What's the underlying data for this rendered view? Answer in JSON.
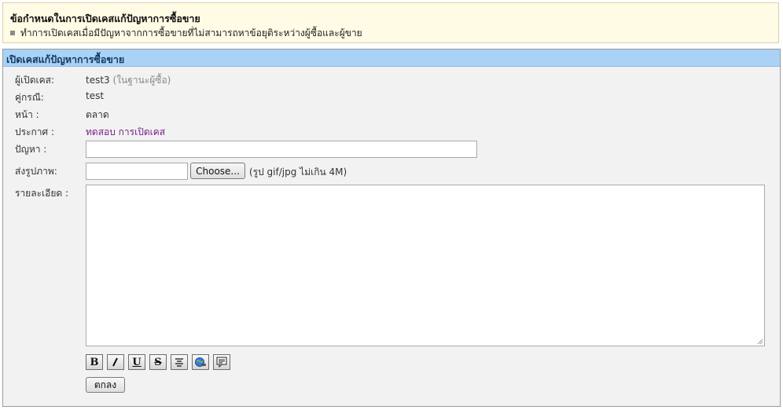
{
  "notice": {
    "title": "ข้อกำหนดในการเปิดเคสแก้ปัญหาการซื้อขาย",
    "items": [
      "ทำการเปิดเคสเมื่อมีปัญหาจากการซื้อขายที่ไม่สามารถหาข้อยุติระหว่างผู้ซื้อและผู้ขาย"
    ]
  },
  "panel": {
    "title": "เปิดเคสแก้ปัญหาการซื้อขาย"
  },
  "form": {
    "opener_label": "ผู้เปิดเคส:",
    "opener_value": "test3",
    "opener_role": "(ในฐานะผู้ซื้อ)",
    "party_label": "คู่กรณี:",
    "party_value": "test",
    "page_label": "หน้า :",
    "page_value": "ตลาด",
    "announce_label": "ประกาศ :",
    "announce_value": "ทดสอบ การเปิดเคส",
    "problem_label": "ปัญหา :",
    "problem_value": "",
    "image_label": "ส่งรูปภาพ:",
    "file_value": "",
    "choose_label": "Choose...",
    "file_note": "(รูป gif/jpg ไม่เกิน 4M)",
    "detail_label": "รายละเอียด :",
    "detail_value": "",
    "toolbar": {
      "bold": "B",
      "italic": "I",
      "underline": "U",
      "strike": "S",
      "icons": [
        "bold-icon",
        "italic-icon",
        "underline-icon",
        "strikethrough-icon",
        "align-center-icon",
        "insert-link-icon",
        "insert-quote-icon"
      ]
    },
    "submit_label": "ตกลง"
  }
}
